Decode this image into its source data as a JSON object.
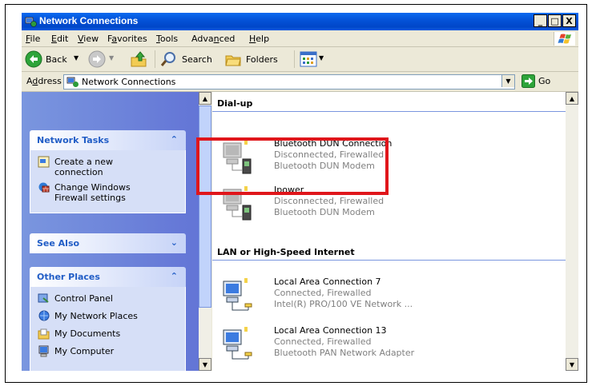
{
  "window": {
    "title": "Network Connections",
    "buttons": {
      "minimize": "_",
      "maximize": "□",
      "close": "X"
    }
  },
  "menu": [
    {
      "label": "File",
      "access": "F",
      "rest": "ile"
    },
    {
      "label": "Edit",
      "access": "E",
      "rest": "dit"
    },
    {
      "label": "View",
      "access": "V",
      "rest": "iew"
    },
    {
      "label": "Favorites",
      "access": "a",
      "pre": "F",
      "rest": "vorites"
    },
    {
      "label": "Tools",
      "access": "T",
      "rest": "ools"
    },
    {
      "label": "Advanced",
      "pre": "Adva",
      "access": "n",
      "rest": "ced"
    },
    {
      "label": "Help",
      "access": "H",
      "rest": "elp"
    }
  ],
  "toolbar": {
    "back_label": "Back",
    "search_label": "Search",
    "folders_label": "Folders"
  },
  "address": {
    "label_access": "d",
    "label_pre": "A",
    "label_rest": "dress",
    "value": "Network Connections",
    "go_label": "Go"
  },
  "tasks": {
    "network_tasks": {
      "title": "Network Tasks",
      "items": [
        {
          "line1": "Create a new",
          "line2": "connection",
          "icon": "new-connection-icon"
        },
        {
          "line1": "Change Windows",
          "line2": "Firewall settings",
          "icon": "firewall-icon"
        }
      ]
    },
    "see_also": {
      "title": "See Also"
    },
    "other_places": {
      "title": "Other Places",
      "items": [
        {
          "label": "Control Panel",
          "icon": "control-panel-icon"
        },
        {
          "label": "My Network Places",
          "icon": "network-places-icon"
        },
        {
          "label": "My Documents",
          "icon": "my-documents-icon"
        },
        {
          "label": "My Computer",
          "icon": "my-computer-icon"
        }
      ]
    }
  },
  "groups": {
    "dialup": {
      "title": "Dial-up",
      "items": [
        {
          "name": "Bluetooth DUN Connection",
          "status": "Disconnected, Firewalled",
          "device": "Bluetooth DUN Modem"
        },
        {
          "name": "Ipower",
          "status": "Disconnected, Firewalled",
          "device": "Bluetooth DUN Modem"
        }
      ]
    },
    "lan": {
      "title": "LAN or High-Speed Internet",
      "items": [
        {
          "name": "Local Area Connection 7",
          "status": "Connected, Firewalled",
          "device": "Intel(R) PRO/100 VE Network ..."
        },
        {
          "name": "Local Area Connection 13",
          "status": "Connected, Firewalled",
          "device": "Bluetooth PAN Network Adapter"
        }
      ]
    }
  },
  "colors": {
    "titlebar": "#0453d8",
    "taskpane": "#6375d6",
    "highlight": "#e0161b"
  }
}
